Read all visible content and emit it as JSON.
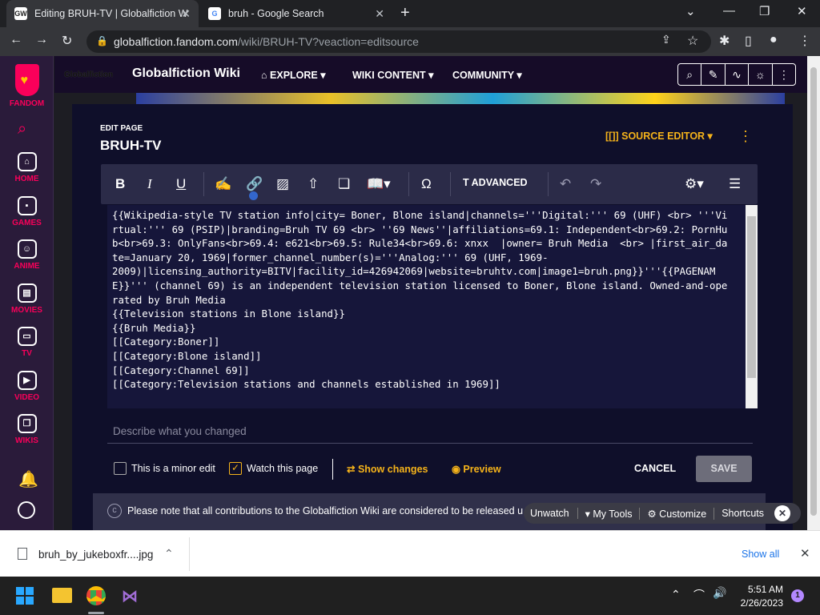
{
  "browser": {
    "tabs": [
      {
        "title": "Editing BRUH-TV | Globalfiction W",
        "favicon": "GW"
      },
      {
        "title": "bruh - Google Search",
        "favicon": "G"
      }
    ],
    "url": {
      "domain": "globalfiction.fandom.com",
      "path": "/wiki/BRUH-TV?veaction=editsource"
    }
  },
  "rail": [
    {
      "label": "FANDOM"
    },
    {
      "label": "HOME",
      "icon": "home-icon"
    },
    {
      "label": "GAMES",
      "icon": "gamepad-icon"
    },
    {
      "label": "ANIME",
      "icon": "anime-icon"
    },
    {
      "label": "MOVIES",
      "icon": "movies-icon"
    },
    {
      "label": "TV",
      "icon": "tv-icon"
    },
    {
      "label": "VIDEO",
      "icon": "video-icon"
    },
    {
      "label": "WIKIS",
      "icon": "wikis-icon"
    }
  ],
  "wiki": {
    "name": "Globalfiction Wiki",
    "logo_text": "Globalfiction",
    "nav": [
      "EXPLORE",
      "WIKI CONTENT",
      "COMMUNITY"
    ]
  },
  "editor": {
    "edit_label": "EDIT PAGE",
    "title": "BRUH-TV",
    "source_editor": "SOURCE EDITOR",
    "advanced": "ADVANCED",
    "wikitext": "{{Wikipedia-style TV station info|city= Boner, Blone island|channels='''Digital:''' 69 (UHF) <br> '''Virtual:''' 69 (PSIP)|branding=Bruh TV 69 <br> ''69 News''|affiliations=69.1: Independent<br>69.2: PornHub<br>69.3: OnlyFans<br>69.4: e621<br>69.5: Rule34<br>69.6: xnxx  |owner= Bruh Media  <br> |first_air_date=January 20, 1969|former_channel_number(s)='''Analog:''' 69 (UHF, 1969-\n2009)|licensing_authority=BITV|facility_id=426942069|website=bruhtv.com|image1=bruh.png}}'''{{PAGENAME}}''' (channel 69) is an independent television station licensed to Boner, Blone island. Owned-and-operated by Bruh Media\n{{Television stations in Blone island}}\n{{Bruh Media}}\n[[Category:Boner]]\n[[Category:Blone island]]\n[[Category:Channel 69]]\n[[Category:Television stations and channels established in 1969]]",
    "summary_placeholder": "Describe what you changed",
    "minor_edit": "This is a minor edit",
    "watch_page": "Watch this page",
    "show_changes": "Show changes",
    "preview": "Preview",
    "cancel": "CANCEL",
    "save": "SAVE",
    "notice": "Please note that all contributions to the Globalfiction Wiki are considered to be released u"
  },
  "user_toolbar": {
    "unwatch": "Unwatch",
    "my_tools": "My Tools",
    "customize": "Customize",
    "shortcuts": "Shortcuts"
  },
  "downloads": {
    "file": "bruh_by_jukeboxfr....jpg",
    "show_all": "Show all"
  },
  "taskbar": {
    "time": "5:51 AM",
    "date": "2/26/2023",
    "notifications": "1"
  },
  "colors": {
    "accent": "#f5b31a",
    "fandom_pink": "#fa005a",
    "panel": "#0f0f2a"
  }
}
